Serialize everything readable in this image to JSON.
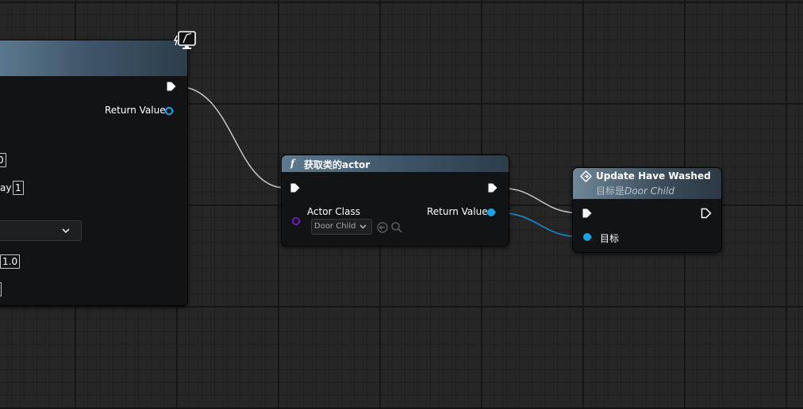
{
  "left_node": {
    "return_label": "Return Value",
    "field_ay": "ay",
    "field_box_0": "0",
    "field_box_1": "1",
    "field_box_10": "1.0"
  },
  "get_actor_node": {
    "function_symbol": "f",
    "title": "获取类的actor",
    "actor_class_label": "Actor Class",
    "actor_class_value": "Door Child",
    "return_label": "Return Value"
  },
  "update_node": {
    "title": "Update Have Washed",
    "subtitle_prefix": "目标是",
    "subtitle_class": "Door Child",
    "target_label": "目标"
  },
  "colors": {
    "exec": "#ffffff",
    "object_pin": "#1aa3e8",
    "class_pin": "#6b1fb8",
    "wire_exec": "#c8c8c8",
    "wire_object": "#1a8fd6"
  }
}
